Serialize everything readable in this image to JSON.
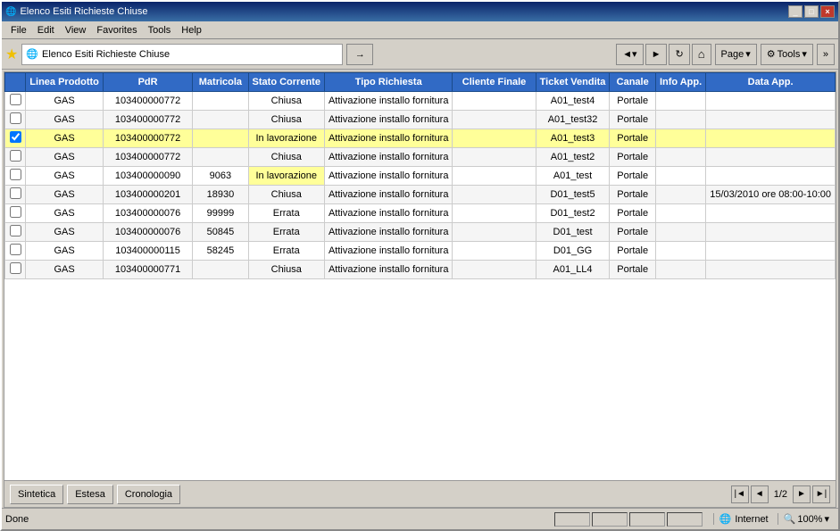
{
  "window": {
    "title": "Elenco Esiti Richieste Chiuse"
  },
  "menubar": {
    "items": [
      "File",
      "Edit",
      "View",
      "Favorites",
      "Tools",
      "Help"
    ]
  },
  "toolbar": {
    "address_label": "Elenco Esiti Richieste Chiuse",
    "page_btn": "Page",
    "tools_btn": "Tools"
  },
  "table": {
    "headers": [
      {
        "key": "check",
        "label": ""
      },
      {
        "key": "linea",
        "label": "Linea Prodotto"
      },
      {
        "key": "pdr",
        "label": "PdR"
      },
      {
        "key": "matricola",
        "label": "Matricola"
      },
      {
        "key": "stato",
        "label": "Stato Corrente"
      },
      {
        "key": "tipo",
        "label": "Tipo Richiesta"
      },
      {
        "key": "cliente",
        "label": "Cliente Finale"
      },
      {
        "key": "ticket",
        "label": "Ticket Vendita"
      },
      {
        "key": "canale",
        "label": "Canale"
      },
      {
        "key": "info",
        "label": "Info App."
      },
      {
        "key": "data",
        "label": "Data App."
      }
    ],
    "rows": [
      {
        "selected": false,
        "linea": "GAS",
        "pdr": "103400000772",
        "matricola": "",
        "stato": "Chiusa",
        "tipo": "Attivazione installo fornitura",
        "cliente": "",
        "ticket": "A01_test4",
        "canale": "Portale",
        "info": "",
        "data": ""
      },
      {
        "selected": false,
        "linea": "GAS",
        "pdr": "103400000772",
        "matricola": "",
        "stato": "Chiusa",
        "tipo": "Attivazione installo fornitura",
        "cliente": "",
        "ticket": "A01_test32",
        "canale": "Portale",
        "info": "",
        "data": ""
      },
      {
        "selected": true,
        "linea": "GAS",
        "pdr": "103400000772",
        "matricola": "",
        "stato": "In lavorazione",
        "tipo": "Attivazione installo fornitura",
        "cliente": "",
        "ticket": "A01_test3",
        "canale": "Portale",
        "info": "",
        "data": ""
      },
      {
        "selected": false,
        "linea": "GAS",
        "pdr": "103400000772",
        "matricola": "",
        "stato": "Chiusa",
        "tipo": "Attivazione installo fornitura",
        "cliente": "",
        "ticket": "A01_test2",
        "canale": "Portale",
        "info": "",
        "data": ""
      },
      {
        "selected": false,
        "linea": "GAS",
        "pdr": "103400000090",
        "matricola": "9063",
        "stato": "In lavorazione",
        "tipo": "Attivazione installo fornitura",
        "cliente": "",
        "ticket": "A01_test",
        "canale": "Portale",
        "info": "",
        "data": ""
      },
      {
        "selected": false,
        "linea": "GAS",
        "pdr": "103400000201",
        "matricola": "18930",
        "stato": "Chiusa",
        "tipo": "Attivazione installo fornitura",
        "cliente": "",
        "ticket": "D01_test5",
        "canale": "Portale",
        "info": "",
        "data": "15/03/2010 ore 08:00-10:00"
      },
      {
        "selected": false,
        "linea": "GAS",
        "pdr": "103400000076",
        "matricola": "99999",
        "stato": "Errata",
        "tipo": "Attivazione installo fornitura",
        "cliente": "",
        "ticket": "D01_test2",
        "canale": "Portale",
        "info": "",
        "data": ""
      },
      {
        "selected": false,
        "linea": "GAS",
        "pdr": "103400000076",
        "matricola": "50845",
        "stato": "Errata",
        "tipo": "Attivazione installo fornitura",
        "cliente": "",
        "ticket": "D01_test",
        "canale": "Portale",
        "info": "",
        "data": ""
      },
      {
        "selected": false,
        "linea": "GAS",
        "pdr": "103400000115",
        "matricola": "58245",
        "stato": "Errata",
        "tipo": "Attivazione installo fornitura",
        "cliente": "",
        "ticket": "D01_GG",
        "canale": "Portale",
        "info": "",
        "data": ""
      },
      {
        "selected": false,
        "linea": "GAS",
        "pdr": "103400000771",
        "matricola": "",
        "stato": "Chiusa",
        "tipo": "Attivazione installo fornitura",
        "cliente": "",
        "ticket": "A01_LL4",
        "canale": "Portale",
        "info": "",
        "data": ""
      }
    ]
  },
  "bottom_buttons": [
    "Sintetica",
    "Estesa",
    "Cronologia"
  ],
  "pagination": {
    "current": "1/2"
  },
  "status": {
    "done": "Done",
    "zone": "Internet",
    "zoom": "100%"
  },
  "icons": {
    "globe": "🌐",
    "star": "★",
    "back": "◄",
    "forward": "►",
    "refresh": "↻",
    "home": "⌂",
    "first": "|◄",
    "prev": "◄",
    "next": "►",
    "last": "►|"
  }
}
